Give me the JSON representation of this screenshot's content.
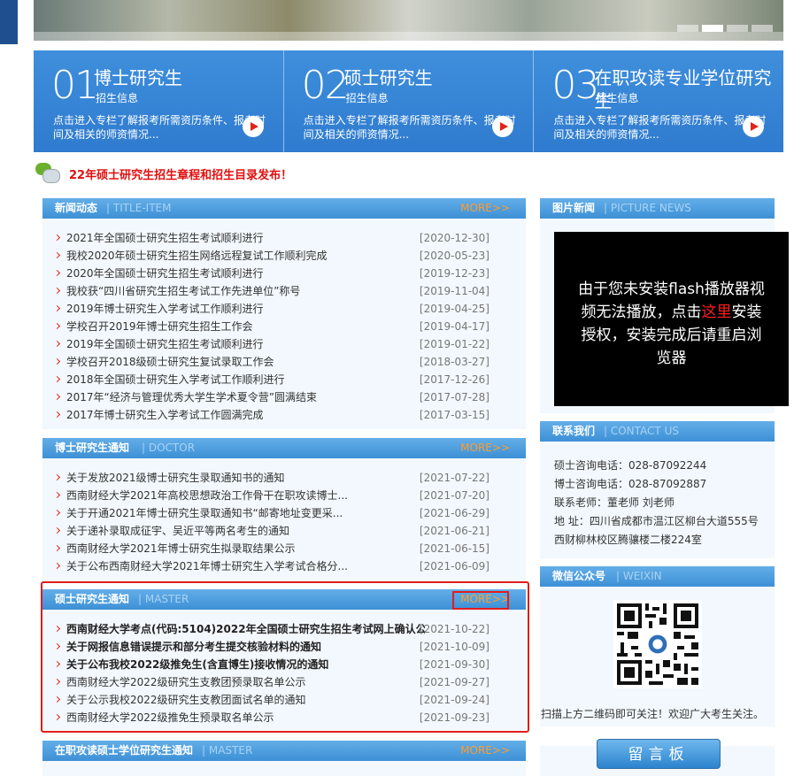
{
  "entries": [
    {
      "num": "01",
      "title": "博士研究生",
      "sub": "招生信息",
      "desc": "点击进入专栏了解报考所需资历条件、报考时间及相关的师资情况..."
    },
    {
      "num": "02",
      "title": "硕士研究生",
      "sub": "招生信息",
      "desc": "点击进入专栏了解报考所需资历条件、报考时间及相关的师资情况..."
    },
    {
      "num": "03",
      "title": "在职攻读专业学位研究生",
      "sub": "招生信息",
      "desc": "点击进入专栏了解报考所需资历条件、报考时间及相关的师资情况..."
    }
  ],
  "notice": "22年硕士研究生招生章程和招生目录发布！",
  "news": {
    "title": "新闻动态",
    "sub": "| TITLE-ITEM",
    "more": "MORE>>",
    "items": [
      {
        "t": "2021年全国硕士研究生招生考试顺利进行",
        "d": "[2020-12-30]"
      },
      {
        "t": "我校2020年硕士研究生招生网络远程复试工作顺利完成",
        "d": "[2020-05-23]"
      },
      {
        "t": "2020年全国硕士研究生招生考试顺利进行",
        "d": "[2019-12-23]"
      },
      {
        "t": "我校获“四川省研究生招生考试工作先进单位”称号",
        "d": "[2019-11-04]"
      },
      {
        "t": "2019年博士研究生入学考试工作顺利进行",
        "d": "[2019-04-25]"
      },
      {
        "t": "学校召开2019年博士研究生招生工作会",
        "d": "[2019-04-17]"
      },
      {
        "t": "2019年全国硕士研究生招生考试顺利进行",
        "d": "[2019-01-22]"
      },
      {
        "t": "学校召开2018级硕士研究生复试录取工作会",
        "d": "[2018-03-27]"
      },
      {
        "t": "2018年全国硕士研究生入学考试工作顺利进行",
        "d": "[2017-12-26]"
      },
      {
        "t": "2017年“经济与管理优秀大学生学术夏令营”圆满结束",
        "d": "[2017-07-28]"
      },
      {
        "t": "2017年博士研究生入学考试工作圆满完成",
        "d": "[2017-03-15]"
      }
    ]
  },
  "doctor": {
    "title": "博士研究生通知",
    "sub": "| DOCTOR",
    "more": "MORE>>",
    "items": [
      {
        "t": "关于发放2021级博士研究生录取通知书的通知",
        "d": "[2021-07-22]"
      },
      {
        "t": "西南财经大学2021年高校思想政治工作骨干在职攻读博士...",
        "d": "[2021-07-20]"
      },
      {
        "t": "关于开通2021年博士研究生录取通知书“邮寄地址变更采...",
        "d": "[2021-06-29]"
      },
      {
        "t": "关于递补录取成征宇、吴近平等两名考生的通知",
        "d": "[2021-06-21]"
      },
      {
        "t": "西南财经大学2021年博士研究生拟录取结果公示",
        "d": "[2021-06-15]"
      },
      {
        "t": "关于公布西南财经大学2021年博士研究生入学考试合格分...",
        "d": "[2021-06-09]"
      }
    ]
  },
  "master": {
    "title": "硕士研究生通知",
    "sub": "| MASTER",
    "more": "MORE>>",
    "items": [
      {
        "t": "西南财经大学考点(代码:5104)2022年全国硕士研究生招生考试网上确认公告",
        "d": "[2021-10-22]",
        "bold": true
      },
      {
        "t": "关于网报信息错误提示和部分考生提交核验材料的通知",
        "d": "[2021-10-09]",
        "bold": true
      },
      {
        "t": "关于公布我校2022级推免生(含直博生)接收情况的通知",
        "d": "[2021-09-30]",
        "bold": true
      },
      {
        "t": "西南财经大学2022级研究生支教团预录取名单公示",
        "d": "[2021-09-27]"
      },
      {
        "t": "关于公示我校2022级研究生支教团面试名单的通知",
        "d": "[2021-09-24]"
      },
      {
        "t": "西南财经大学2022级推免生预录取名单公示",
        "d": "[2021-09-23]"
      }
    ]
  },
  "parttime": {
    "title": "在职攻读硕士学位研究生通知",
    "sub": "| MASTER",
    "more": "MORE>>"
  },
  "picture": {
    "title": "图片新闻",
    "sub": "| PICTURE NEWS",
    "flash_before": "由于您未安装flash播放器视频无法播放，点击",
    "flash_link": "这里",
    "flash_after": "安装授权，安装完成后请重启浏览器"
  },
  "contact": {
    "title": "联系我们",
    "sub": "| CONTACT US",
    "lines": [
      "硕士咨询电话：028-87092244",
      "博士咨询电话：028-87092887",
      "联系老师：董老师 刘老师",
      "地 址：四川省成都市温江区柳台大道555号",
      "西财柳林校区腾骧楼二楼224室"
    ]
  },
  "weixin": {
    "title": "微信公众号",
    "sub": "| WEIXIN",
    "caption": "扫描上方二维码即可关注！欢迎广大考生关注。"
  },
  "message_button": "留言板"
}
